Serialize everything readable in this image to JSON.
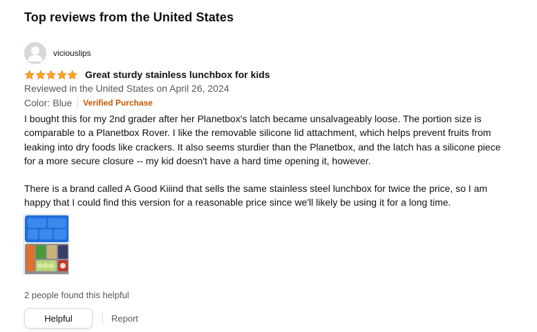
{
  "section": {
    "heading": "Top reviews from the United States"
  },
  "review": {
    "profile_name": "viciouslips",
    "rating": 5,
    "rating_max": 5,
    "title": "Great sturdy stainless lunchbox for kids",
    "reviewed_in": "Reviewed in the United States on April 26, 2024",
    "variant": "Color: Blue",
    "verified_label": "Verified Purchase",
    "body_p1": "I bought this for my 2nd grader after her Planetbox's latch became unsalvageably loose. The portion size is comparable to a Planetbox Rover. I like the removable silicone lid attachment, which helps prevent fruits from leaking into dry foods like crackers. It also seems sturdier than the Planetbox, and the latch has a silicone piece for a more secure closure -- my kid doesn't have a hard time opening it, however.",
    "body_p2": "There is a brand called A Good Kiiind that sells the same stainless steel lunchbox for twice the price, so I am happy that I could find this version for a reasonable price since we'll likely be using it for a long time.",
    "helpful_count_text": "2 people found this helpful",
    "helpful_button": "Helpful",
    "report_link": "Report"
  },
  "icons": {
    "avatar": "user-avatar-icon",
    "star": "star-icon"
  },
  "colors": {
    "star": "#ffa41c",
    "star_stroke": "#de7921",
    "verified": "#c45500",
    "muted_text": "#565959",
    "text": "#0f1111",
    "border": "#d5d9d9",
    "lunchbox_lid": "#1e6fd9"
  }
}
